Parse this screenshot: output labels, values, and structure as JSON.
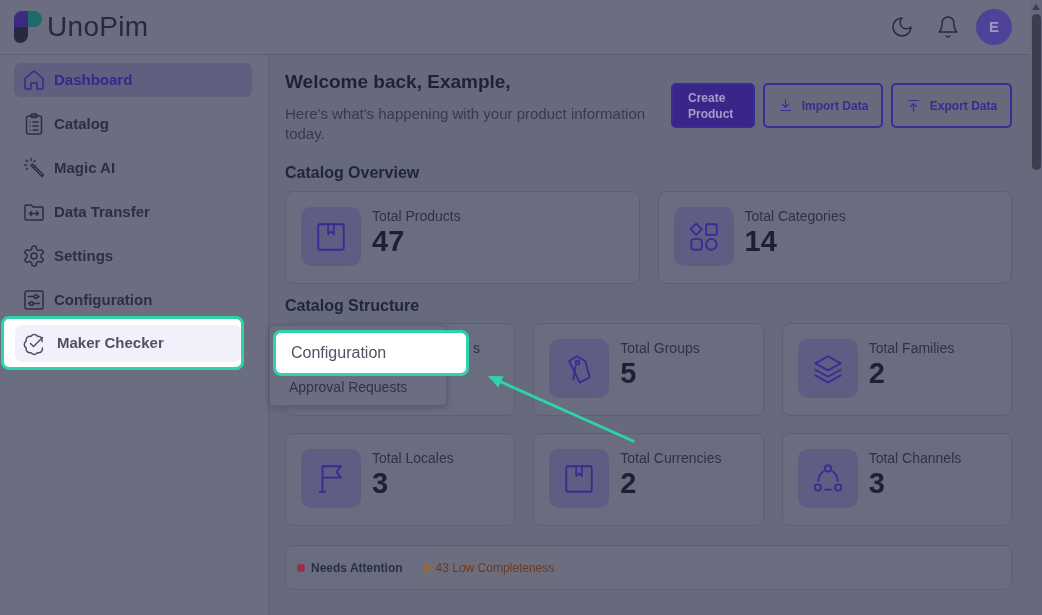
{
  "header": {
    "logo": "UnoPim",
    "avatar": "E"
  },
  "sidebar": {
    "items": [
      {
        "label": "Dashboard",
        "selected": true,
        "highlighted": false
      },
      {
        "label": "Catalog",
        "selected": false,
        "highlighted": false
      },
      {
        "label": "Magic AI",
        "selected": false,
        "highlighted": false
      },
      {
        "label": "Data Transfer",
        "selected": false,
        "highlighted": false
      },
      {
        "label": "Settings",
        "selected": false,
        "highlighted": false
      },
      {
        "label": "Configuration",
        "selected": false,
        "highlighted": false
      },
      {
        "label": "Maker Checker",
        "selected": false,
        "highlighted": true
      }
    ]
  },
  "welcome": {
    "title": "Welcome back, Example,",
    "subtitle": "Here's what's happening with your product information today."
  },
  "actions": [
    {
      "label": "Create Product",
      "kind": "primary"
    },
    {
      "label": "Import Data",
      "kind": "outline"
    },
    {
      "label": "Export Data",
      "kind": "outline"
    }
  ],
  "overview": {
    "title": "Catalog Overview",
    "cards": [
      {
        "label": "Total Products",
        "value": "47",
        "covered": false
      },
      {
        "label": "Total Categories",
        "value": "14",
        "covered": false
      }
    ]
  },
  "structure": {
    "title": "Catalog Structure",
    "cards": [
      {
        "label": "s",
        "covered": true
      },
      {
        "label": "Total Groups",
        "value": "5",
        "covered": false
      },
      {
        "label": "Total Families",
        "value": "2",
        "covered": false
      },
      {
        "label": "Total Locales",
        "value": "3",
        "covered": false
      },
      {
        "label": "Total Currencies",
        "value": "2",
        "covered": false
      },
      {
        "label": "Total Channels",
        "value": "3",
        "covered": false
      }
    ]
  },
  "attention": {
    "label": "Needs Attention",
    "color": "#9a2d45",
    "tags": [
      {
        "text": "43 Low Completeness",
        "color": "#a4661b"
      }
    ]
  },
  "submenu": {
    "items": [
      {
        "label": "Configuration",
        "highlighted": true
      },
      {
        "label": "Approval Requests",
        "highlighted": false
      }
    ]
  }
}
